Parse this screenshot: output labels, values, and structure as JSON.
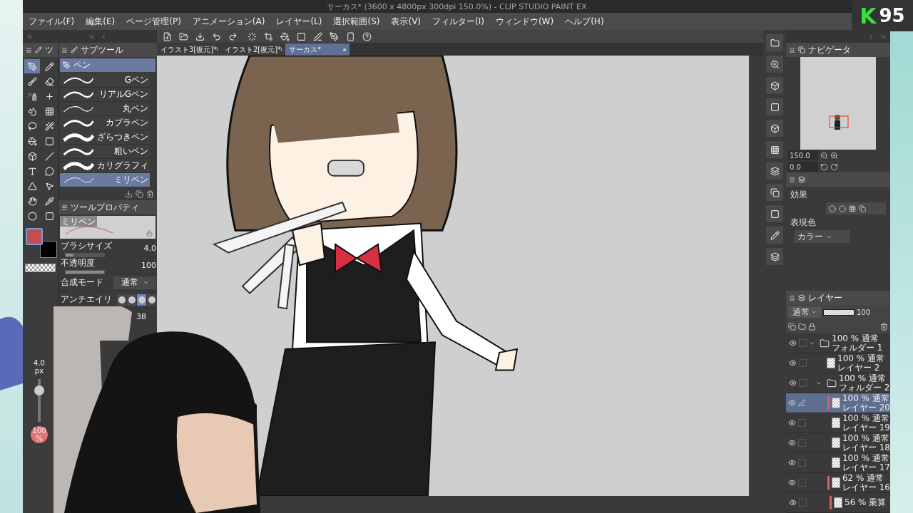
{
  "window": {
    "title": "サーカス* (3600 x 4800px 300dpi 150.0%) - CLIP STUDIO PAINT EX"
  },
  "menu": [
    "ファイル(F)",
    "編集(E)",
    "ページ管理(P)",
    "アニメーション(A)",
    "レイヤー(L)",
    "選択範囲(S)",
    "表示(V)",
    "フィルター(I)",
    "ウィンドウ(W)",
    "ヘルプ(H)"
  ],
  "document_tabs": [
    {
      "label": "イラスト3[復元]*",
      "selected": false
    },
    {
      "label": "イラスト2[復元]*",
      "selected": false
    },
    {
      "label": "サーカス*",
      "selected": true
    }
  ],
  "tool_panel": {
    "tab": "ツ",
    "tools": [
      {
        "selected": true
      },
      {
        "selected": false
      },
      {
        "selected": false
      },
      {
        "selected": false
      },
      {
        "selected": false
      },
      {
        "selected": false
      },
      {
        "selected": false
      },
      {
        "selected": false
      },
      {
        "selected": false
      },
      {
        "selected": false
      },
      {
        "selected": false
      },
      {
        "selected": false
      },
      {
        "selected": false
      },
      {
        "selected": false
      },
      {
        "selected": false
      },
      {
        "selected": false
      },
      {
        "selected": false
      },
      {
        "selected": false
      },
      {
        "selected": false
      },
      {
        "selected": false
      },
      {
        "selected": false
      },
      {
        "selected": false
      }
    ]
  },
  "color_swatches": [
    {
      "kind": "main",
      "color": "#c24f4c"
    },
    {
      "kind": "sub",
      "color": "#000000"
    }
  ],
  "brush_indicator": {
    "size": "4.0",
    "size_unit": "px",
    "level": 0.8,
    "opacity": "100",
    "opacity_unit": "%"
  },
  "subtool": {
    "tab": "サブツール",
    "group": "ペン",
    "brushes": [
      {
        "name": "Gペン",
        "selected": false
      },
      {
        "name": "リアルGペン",
        "selected": false
      },
      {
        "name": "丸ペン",
        "selected": false
      },
      {
        "name": "カブラペン",
        "selected": false
      },
      {
        "name": "ざらつきペン",
        "selected": false
      },
      {
        "name": "粗いペン",
        "selected": false
      },
      {
        "name": "カリグラフィ",
        "selected": false
      },
      {
        "name": "ミリペン",
        "selected": true
      }
    ]
  },
  "tool_property": {
    "tab": "ツールプロパティ",
    "preview": "ミリペン",
    "properties": [
      {
        "kind": "slider",
        "label": "ブラシサイズ",
        "value": "4.0",
        "level": 0.2
      },
      {
        "kind": "slider",
        "label": "不透明度",
        "value": "100",
        "level": 1
      },
      {
        "kind": "select",
        "label": "合成モード",
        "value": "通常"
      },
      {
        "kind": "shape",
        "label": "アンチエイリ",
        "options": [
          {
            "selected": false
          },
          {
            "selected": false
          },
          {
            "selected": true
          },
          {
            "selected": false
          }
        ]
      },
      {
        "kind": "number",
        "value": "38"
      }
    ]
  },
  "navigator": {
    "tab": "ナビゲータ",
    "zoom": "150.0",
    "angle": "0.0"
  },
  "layer_property": {
    "effect_label": "効果",
    "color_label": "表現色",
    "color_mode": "カラー"
  },
  "layers": {
    "tab": "レイヤー",
    "blend": "通常",
    "opacity": "100",
    "level": 1,
    "items": [
      {
        "kind": "folder",
        "mode": "100 % 通常",
        "name": "フォルダー 1",
        "selected": false,
        "expanded": true,
        "children": [
          {
            "kind": "layer",
            "mode": "100 % 通常",
            "name": "レイヤー 2",
            "selected": false
          },
          {
            "kind": "folder",
            "mode": "100 % 通常",
            "name": "フォルダー 2",
            "selected": false,
            "expanded": true,
            "children": [
              {
                "kind": "layer",
                "mode": "100 % 通常",
                "name": "レイヤー 20",
                "selected": true,
                "color": "#d9606a"
              },
              {
                "kind": "layer",
                "mode": "100 % 通常",
                "name": "レイヤー 19",
                "selected": false
              },
              {
                "kind": "layer",
                "mode": "100 % 通常",
                "name": "レイヤー 18",
                "selected": false
              },
              {
                "kind": "layer",
                "mode": "100 % 通常",
                "name": "レイヤー 17",
                "selected": false
              },
              {
                "kind": "layer",
                "mode": "62 % 通常",
                "name": "レイヤー 16",
                "selected": false,
                "color": "#d9606a"
              },
              {
                "kind": "layer",
                "mode": "56 % 乗算",
                "selected": false,
                "color": "#d9606a"
              }
            ]
          }
        ]
      }
    ]
  },
  "overlay": {
    "logo_letter": "K",
    "logo_number": "95"
  }
}
